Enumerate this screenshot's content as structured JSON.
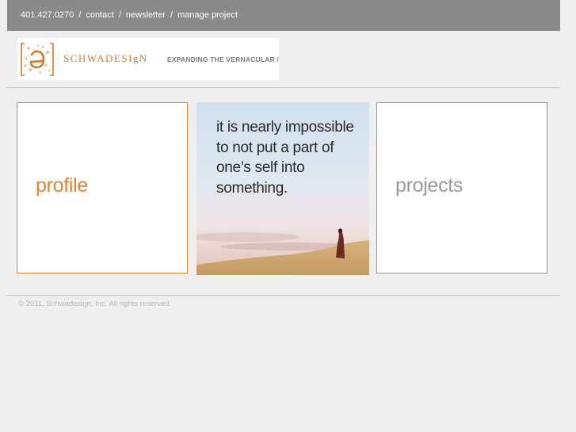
{
  "nav": {
    "phone": "401.427.0270",
    "separator": "/",
    "contact": "contact",
    "newsletter": "newsletter",
    "manage_project": "manage project"
  },
  "logo": {
    "name": "SCHWADESIgN",
    "tagline": "EXPANDING THE VERNACULAR /"
  },
  "tiles": {
    "profile": "profile",
    "projects": "projects",
    "quote": "it is nearly impossible to not put a part of one’s self into something."
  },
  "footer": {
    "copyright": "© 2011, Schwadesign, Inc. All rights reserved."
  },
  "colors": {
    "accent": "#e0822e",
    "topbar": "#8a8a8a",
    "background": "#efefef"
  }
}
